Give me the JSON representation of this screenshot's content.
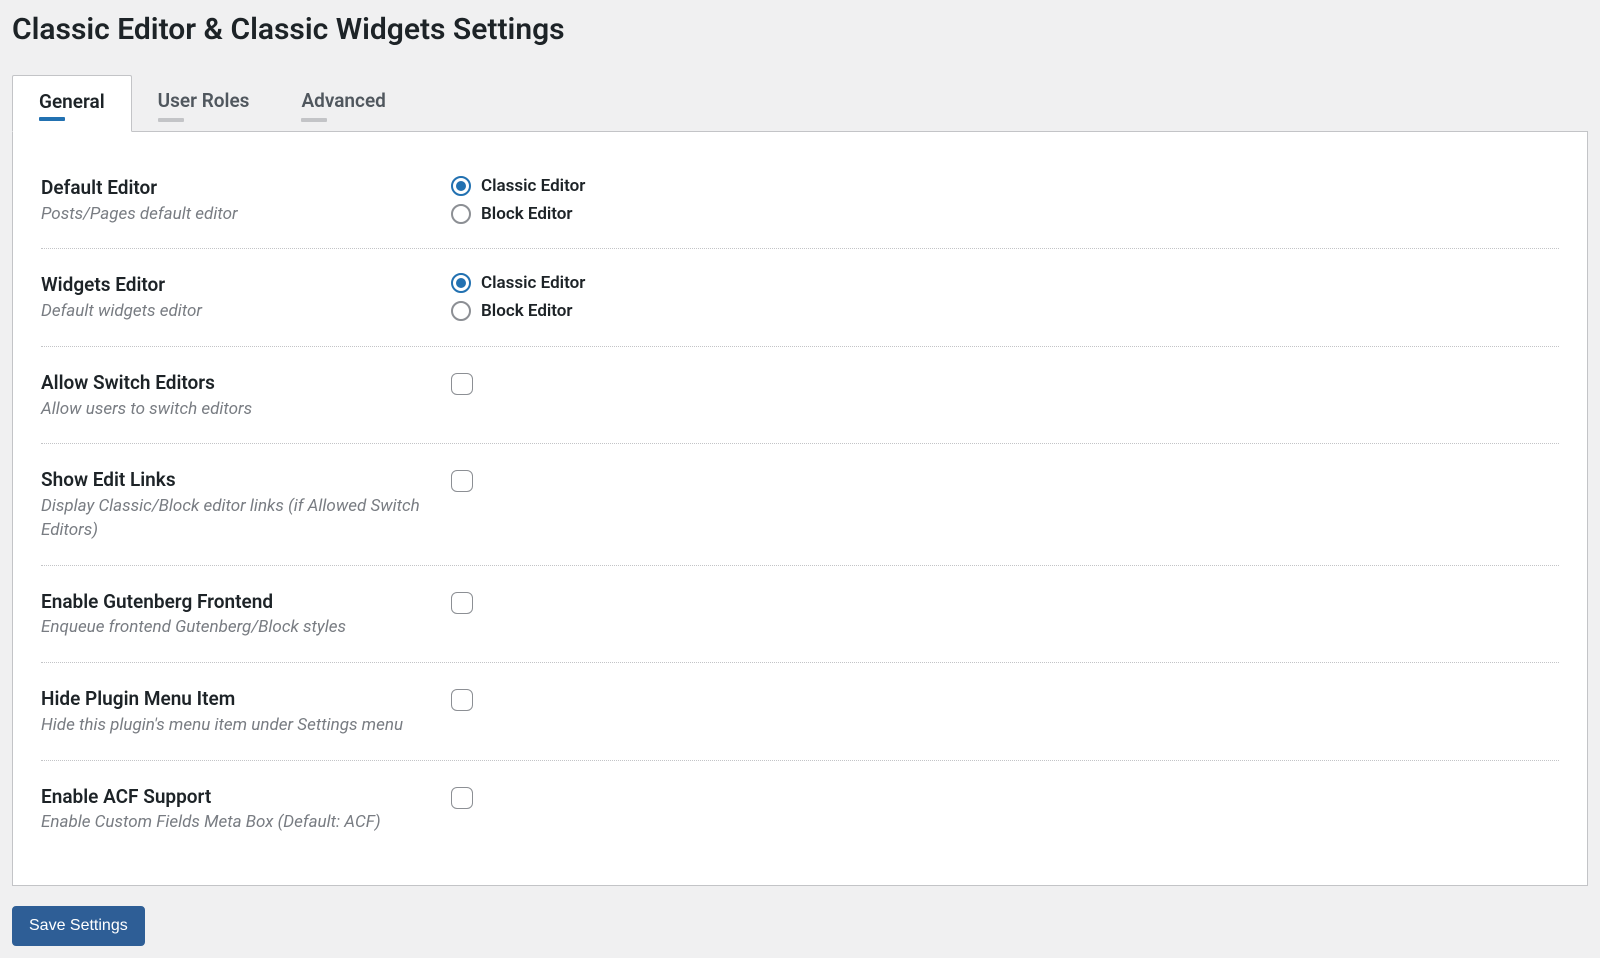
{
  "page_title": "Classic Editor & Classic Widgets Settings",
  "tabs": [
    {
      "label": "General",
      "active": true
    },
    {
      "label": "User Roles",
      "active": false
    },
    {
      "label": "Advanced",
      "active": false
    }
  ],
  "settings": {
    "default_editor": {
      "title": "Default Editor",
      "desc": "Posts/Pages default editor",
      "options": {
        "classic": "Classic Editor",
        "block": "Block Editor"
      },
      "selected": "classic"
    },
    "widgets_editor": {
      "title": "Widgets Editor",
      "desc": "Default widgets editor",
      "options": {
        "classic": "Classic Editor",
        "block": "Block Editor"
      },
      "selected": "classic"
    },
    "allow_switch": {
      "title": "Allow Switch Editors",
      "desc": "Allow users to switch editors",
      "checked": false
    },
    "show_edit_links": {
      "title": "Show Edit Links",
      "desc": "Display Classic/Block editor links (if Allowed Switch Editors)",
      "checked": false
    },
    "gutenberg_frontend": {
      "title": "Enable Gutenberg Frontend",
      "desc": "Enqueue frontend Gutenberg/Block styles",
      "checked": false
    },
    "hide_plugin_menu": {
      "title": "Hide Plugin Menu Item",
      "desc": "Hide this plugin's menu item under Settings menu",
      "checked": false
    },
    "acf_support": {
      "title": "Enable ACF Support",
      "desc": "Enable Custom Fields Meta Box (Default: ACF)",
      "checked": false
    }
  },
  "actions": {
    "save_label": "Save Settings"
  }
}
